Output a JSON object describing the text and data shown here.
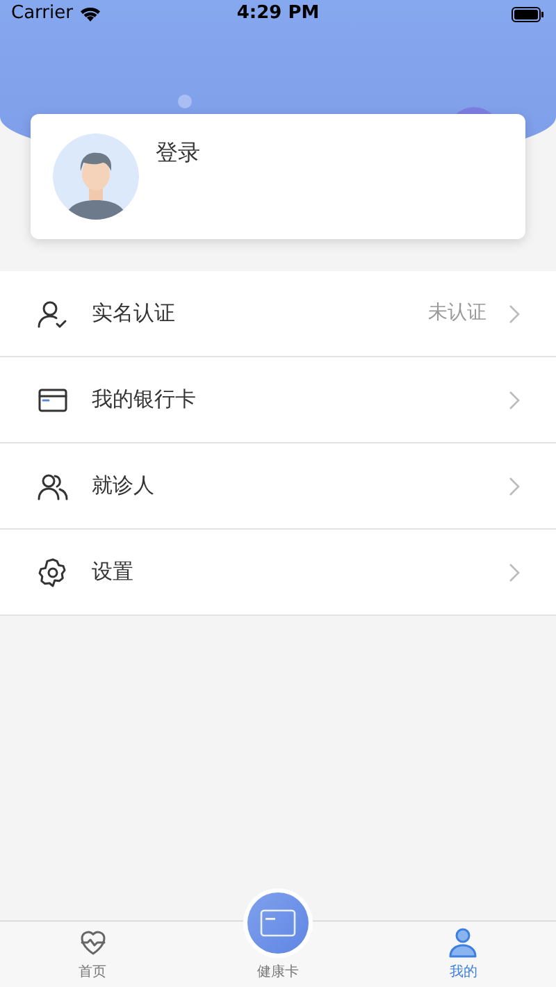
{
  "status_bar": {
    "carrier": "Carrier",
    "time": "4:29 PM"
  },
  "profile": {
    "login": "登录"
  },
  "menu": [
    {
      "label": "实名认证",
      "value": "未认证"
    },
    {
      "label": "我的银行卡"
    },
    {
      "label": "就诊人"
    },
    {
      "label": "设置"
    }
  ],
  "tab_bar": [
    {
      "label": "首页",
      "selected": false
    },
    {
      "label": "健康卡",
      "selected": false
    },
    {
      "label": "我的",
      "selected": true
    }
  ]
}
